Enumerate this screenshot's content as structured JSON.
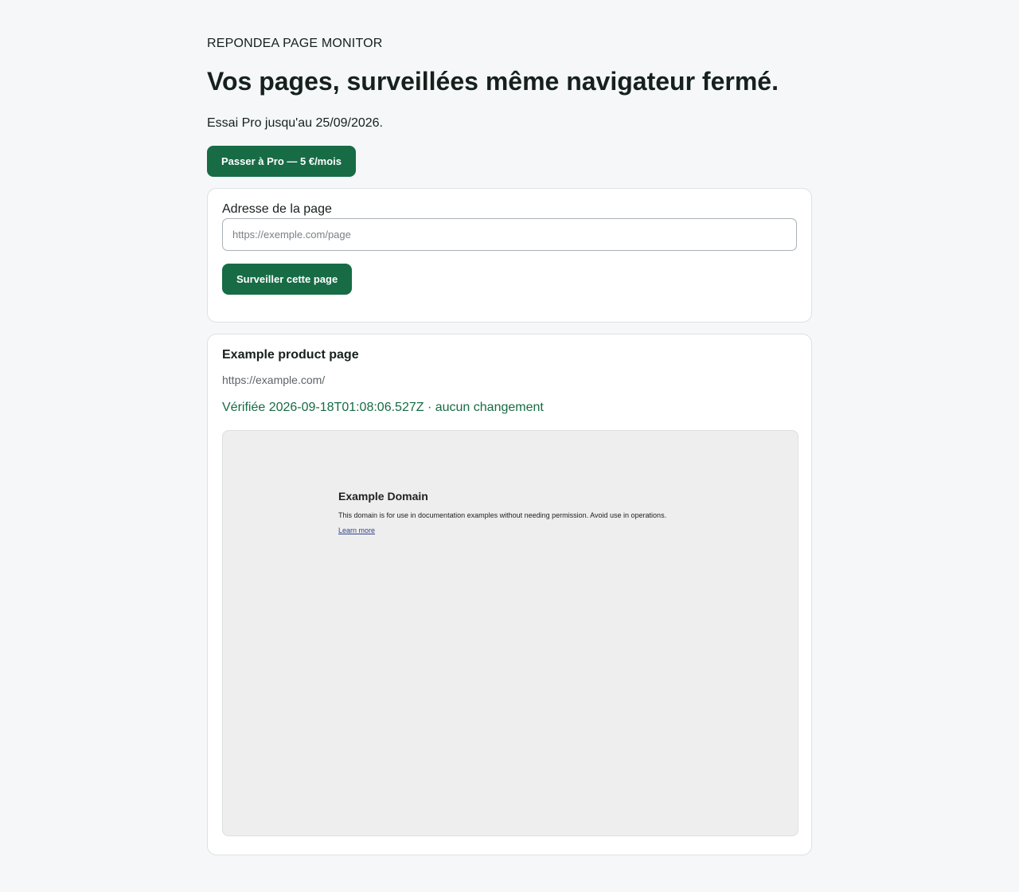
{
  "header": {
    "brand": "REPONDEA PAGE MONITOR",
    "headline": "Vos pages, surveillées même navigateur fermé.",
    "trial_text": "Essai Pro jusqu'au 25/09/2026.",
    "upgrade_label": "Passer à Pro — 5 €/mois"
  },
  "form": {
    "address_label": "Adresse de la page",
    "address_value": "",
    "address_placeholder": "https://exemple.com/page",
    "submit_label": "Surveiller cette page"
  },
  "monitored_page": {
    "title": "Example product page",
    "url": "https://example.com/",
    "status": "Vérifiée 2026-09-18T01:08:06.527Z · aucun changement",
    "snapshot": {
      "title": "Example Domain",
      "text": "This domain is for use in documentation examples without needing permission. Avoid use in operations.",
      "link": "Learn more"
    }
  },
  "colors": {
    "accent": "#176b45",
    "background": "#f5f7f9",
    "card": "#ffffff",
    "snapshot_bg": "#eeeeee"
  }
}
